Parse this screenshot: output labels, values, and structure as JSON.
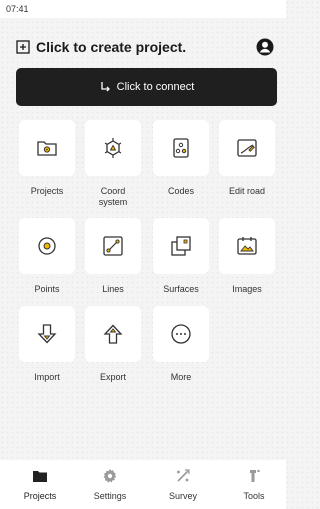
{
  "status_bar": {
    "time": "07:41"
  },
  "header": {
    "title": "Click to create project."
  },
  "connect": {
    "label": "Click to connect"
  },
  "grid": [
    {
      "label": "Projects"
    },
    {
      "label": "Coord\nsystem"
    },
    {
      "label": "Codes"
    },
    {
      "label": "Edit road"
    },
    {
      "label": "Points"
    },
    {
      "label": "Lines"
    },
    {
      "label": "Surfaces"
    },
    {
      "label": "Images"
    },
    {
      "label": "Import"
    },
    {
      "label": "Export"
    },
    {
      "label": "More"
    }
  ],
  "bottom_nav": [
    {
      "label": "Projects",
      "icon": "folder-icon",
      "active": true
    },
    {
      "label": "Settings",
      "icon": "gear-icon",
      "active": false
    },
    {
      "label": "Survey",
      "icon": "survey-icon",
      "active": false
    },
    {
      "label": "Tools",
      "icon": "tools-icon",
      "active": false
    }
  ],
  "colors": {
    "accent": "#f5b800",
    "dark": "#1f1f1f",
    "icon_inactive": "#9a9a9a"
  }
}
